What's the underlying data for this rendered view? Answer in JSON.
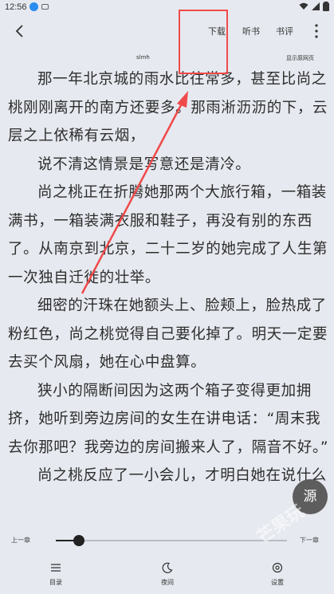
{
  "status_bar": {
    "time": "12:56"
  },
  "nav": {
    "tabs": [
      {
        "label": "下载"
      },
      {
        "label": "听书"
      },
      {
        "label": "书评"
      }
    ]
  },
  "chapter": {
    "title": "slmh",
    "show_source_label": "显示原网页"
  },
  "content": {
    "paragraphs": [
      "那一年北京城的雨水比往常多，甚至比尚之桃刚刚离开的南方还要多。那雨淅沥沥的下，云层之上依稀有云烟，",
      "说不清这情景是写意还是清冷。",
      "尚之桃正在折腾她那两个大旅行箱，一箱装满书，一箱装满衣服和鞋子，再没有别的东西了。从南京到北京，二十二岁的她完成了人生第一次独自迁徙的壮举。",
      "细密的汗珠在她额头上、脸颊上，脸热成了粉红色，尚之桃觉得自己要化掉了。明天一定要去买个风扇，她在心中盘算。",
      "狭小的隔断间因为这两个箱子变得更加拥挤，她听到旁边房间的女生在讲电话：“周末我去你那吧？我旁边的房间搬来人了，隔音不好。”",
      "尚之桃反应了一小会儿，才明白她在说什么"
    ]
  },
  "progress": {
    "prev_label": "上一章",
    "next_label": "下一章",
    "value_fraction": 0.1
  },
  "source_button": {
    "label": "源"
  },
  "watermark": {
    "text": "芒果玩"
  },
  "bottom_nav": [
    {
      "label": "目录",
      "icon": "menu-icon"
    },
    {
      "label": "夜间",
      "icon": "moon-icon"
    },
    {
      "label": "设置",
      "icon": "gear-icon"
    }
  ],
  "annotation": {
    "color": "#f04a4a"
  }
}
